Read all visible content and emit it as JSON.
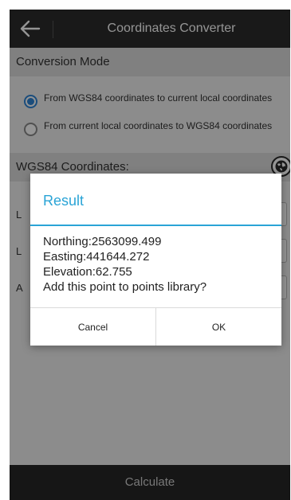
{
  "title": "Coordinates Converter",
  "conversion_mode": {
    "header": "Conversion Mode",
    "options": [
      {
        "label": "From WGS84 coordinates to current local coordinates",
        "selected": true
      },
      {
        "label": "From current local coordinates to WGS84 coordinates",
        "selected": false
      }
    ]
  },
  "wgs84": {
    "header": "WGS84 Coordinates:",
    "fields": [
      {
        "label": "L"
      },
      {
        "label": "L"
      },
      {
        "label": "A"
      }
    ]
  },
  "calculate_label": "Calculate",
  "dialog": {
    "title": "Result",
    "lines": [
      "Northing:2563099.499",
      "Easting:441644.272",
      "Elevation:62.755",
      "Add this point to points library?"
    ],
    "cancel_label": "Cancel",
    "ok_label": "OK"
  },
  "colors": {
    "accent": "#2aa4d6",
    "radio_selected": "#2f86d6",
    "titlebar": "#2c2c2c"
  },
  "icons": {
    "back": "arrow-left-icon",
    "globe": "globe-icon"
  }
}
